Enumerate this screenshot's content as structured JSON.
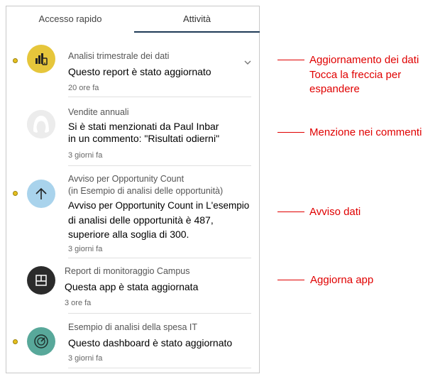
{
  "tabs": {
    "quick_access": "Accesso rapido",
    "activity": "Attività"
  },
  "items": [
    {
      "title": "Analisi trimestrale dei dati",
      "body_lines": [
        "Questo report è stato aggiornato"
      ],
      "time": "20 ore fa",
      "icon": "report-chart-icon",
      "icon_color": "#e6c63b",
      "unread": true
    },
    {
      "title": "Vendite annuali",
      "body_lines": [
        "Si è stati menzionati da Paul Inbar",
        "in un commento: \"Risultati odierni\""
      ],
      "time": "3 giorni fa",
      "icon": "user-avatar-icon",
      "icon_color": "#e8e8e8",
      "unread": false
    },
    {
      "title_lines": [
        "Avviso per Opportunity Count",
        "(in Esempio di analisi delle opportunità)"
      ],
      "body_lines": [
        "Avviso per Opportunity Count in L'esempio",
        "di analisi delle opportunità è 487,",
        "superiore alla soglia di 300."
      ],
      "time": "3 giorni fa",
      "icon": "arrow-up-icon",
      "icon_color": "#a9d3ec",
      "unread": true
    },
    {
      "title": "Report di monitoraggio Campus",
      "body_lines": [
        "Questa app è stata aggiornata"
      ],
      "time": "3 ore fa",
      "icon": "app-grid-icon",
      "icon_color": "#2b2b2b",
      "unread": false
    },
    {
      "title": "Esempio di analisi della spesa IT",
      "body_lines": [
        "Questo dashboard è stato aggiornato"
      ],
      "time": "3 giorni fa",
      "icon": "gauge-icon",
      "icon_color": "#58a89a",
      "unread": true
    }
  ],
  "callouts": {
    "data_update": [
      "Aggiornamento dei dati",
      "Tocca la freccia per",
      "espandere"
    ],
    "mention": "Menzione nei commenti",
    "alert": "Avviso dati",
    "app_update": "Aggiorna app"
  },
  "colors": {
    "callout": "#e00000",
    "unread_dot": "#e6c01e",
    "tab_underline": "#1f3b57"
  }
}
